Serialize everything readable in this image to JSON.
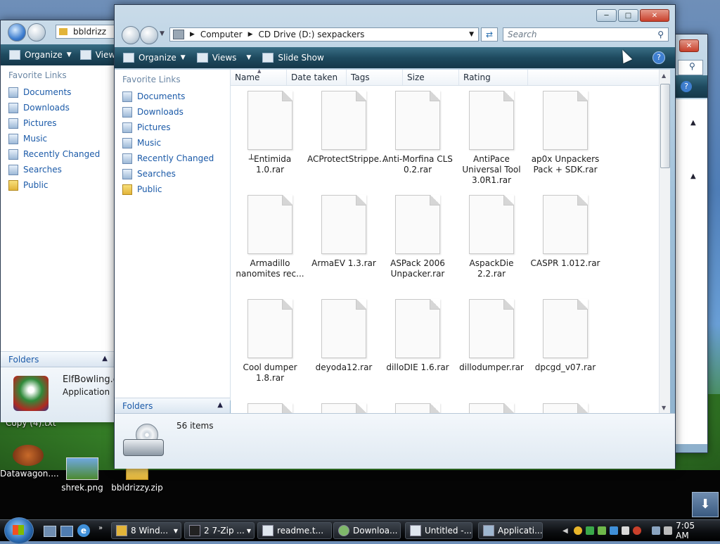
{
  "desktop": {
    "icons": [
      {
        "label": "Datawagon...."
      },
      {
        "label": "shrek.png"
      },
      {
        "label": "bbldrizzy.zip"
      }
    ],
    "partial_label": "Copy (4).txt"
  },
  "back_window": {
    "address_partial": "bbldrizz",
    "toolbar": {
      "organize": "Organize",
      "views": "View"
    },
    "favorite_links_header": "Favorite Links",
    "links": [
      "Documents",
      "Downloads",
      "Pictures",
      "Music",
      "Recently Changed",
      "Searches",
      "Public"
    ],
    "folders_label": "Folders",
    "details": {
      "name": "ElfBowling.ex",
      "type": "Application"
    }
  },
  "main_window": {
    "breadcrumb": [
      "Computer",
      "CD Drive (D:) sexpackers"
    ],
    "search_placeholder": "Search",
    "toolbar": {
      "organize": "Organize",
      "views": "Views",
      "slideshow": "Slide Show"
    },
    "favorite_links_header": "Favorite Links",
    "links": [
      "Documents",
      "Downloads",
      "Pictures",
      "Music",
      "Recently Changed",
      "Searches",
      "Public"
    ],
    "folders_label": "Folders",
    "columns": [
      "Name",
      "Date taken",
      "Tags",
      "Size",
      "Rating"
    ],
    "files": [
      "┴Entimida 1.0.rar",
      "ACProtectStrippe...",
      "Anti-Morfina CLS 0.2.rar",
      "AntiPace Universal Tool 3.0R1.rar",
      "ap0x Unpackers Pack + SDK.rar",
      "Armadillo nanomites rec...",
      "ArmaEV 1.3.rar",
      "ASPack 2006 Unpacker.rar",
      "AspackDie 2.2.rar",
      "CASPR 1.012.rar",
      "Cool dumper 1.8.rar",
      "deyoda12.rar",
      "dilloDIE 1.6.rar",
      "dillodumper.rar",
      "dpcgd_v07.rar"
    ],
    "item_count": "56 items"
  },
  "taskbar": {
    "tasks": [
      {
        "label": "8 Wind...",
        "bold_prefix": "8"
      },
      {
        "label": "2 7-Zip ...",
        "bold_prefix": "2"
      },
      {
        "label": "readme.t..."
      },
      {
        "label": "Downloa..."
      },
      {
        "label": "Untitled -..."
      },
      {
        "label": "Applicati..."
      }
    ],
    "clock": "7:05 AM"
  },
  "colors": {
    "link": "#1b5aa8",
    "toolbar_dark": "#1e4a5f",
    "close_red": "#c9402b"
  }
}
